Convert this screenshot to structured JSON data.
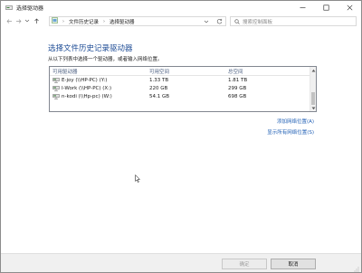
{
  "window": {
    "title": "选择驱动器",
    "icons": {
      "app": "drive-icon",
      "minimize": "minimize-icon",
      "maximize": "maximize-icon",
      "close": "close-icon"
    }
  },
  "address": {
    "crumbs": [
      "文件历史记录",
      "选择驱动器"
    ],
    "search_placeholder": "搜索控制面板"
  },
  "content": {
    "heading": "选择文件历史记录驱动器",
    "subtext": "从以下列表中选择一个驱动器，或者输入网络位置。",
    "columns": [
      "可用驱动器",
      "可用空间",
      "总空间"
    ],
    "drives": [
      {
        "name": "E-joy (\\\\HP-PC) (Y:)",
        "free": "1.33 TB",
        "total": "1.81 TB"
      },
      {
        "name": "I-Work (\\\\HP-PC) (X:)",
        "free": "220 GB",
        "total": "299 GB"
      },
      {
        "name": "n-kodi (\\\\Hp-pc) (W:)",
        "free": "54.1 GB",
        "total": "698 GB"
      }
    ],
    "links": {
      "add_network": "添加网络位置(A)",
      "show_all": "显示所有网络位置(S)"
    }
  },
  "footer": {
    "ok_label": "确定",
    "cancel_label": "取消",
    "ok_enabled": false
  },
  "colors": {
    "heading": "#1f4d96",
    "link": "#1f5fb5",
    "drive_icon": "#3a7d3a"
  }
}
